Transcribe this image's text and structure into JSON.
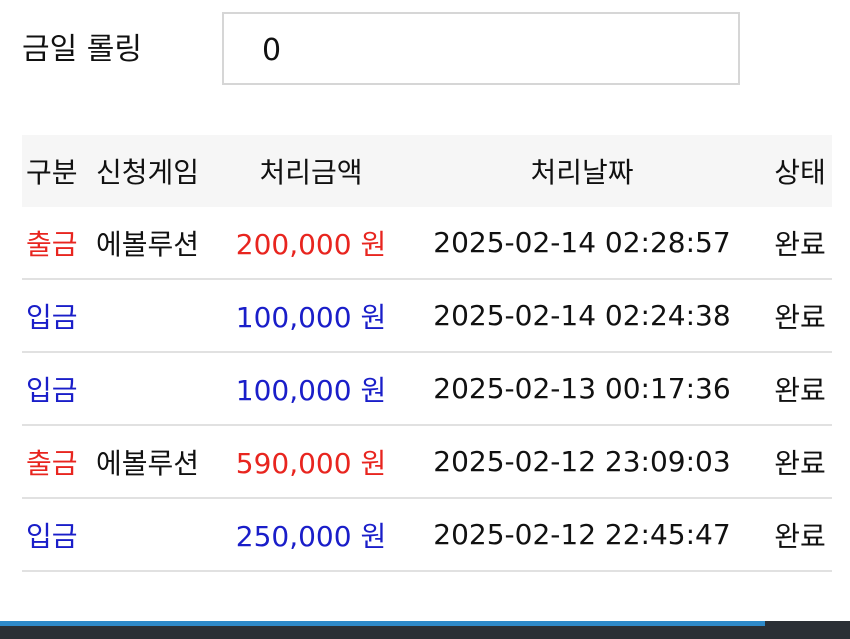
{
  "rolling": {
    "label": "금일 롤링",
    "value": "0"
  },
  "table": {
    "headers": {
      "type": "구분",
      "game": "신청게임",
      "amount": "처리금액",
      "date": "처리날짜",
      "status": "상태"
    },
    "rows": [
      {
        "type": "출금",
        "kind": "withdraw",
        "game": "에볼루션",
        "amount": "200,000 원",
        "date": "2025-02-14 02:28:57",
        "status": "완료"
      },
      {
        "type": "입금",
        "kind": "deposit",
        "game": "",
        "amount": "100,000 원",
        "date": "2025-02-14 02:24:38",
        "status": "완료"
      },
      {
        "type": "입금",
        "kind": "deposit",
        "game": "",
        "amount": "100,000 원",
        "date": "2025-02-13 00:17:36",
        "status": "완료"
      },
      {
        "type": "출금",
        "kind": "withdraw",
        "game": "에볼루션",
        "amount": "590,000 원",
        "date": "2025-02-12 23:09:03",
        "status": "완료"
      },
      {
        "type": "입금",
        "kind": "deposit",
        "game": "",
        "amount": "250,000 원",
        "date": "2025-02-12 22:45:47",
        "status": "완료"
      }
    ]
  },
  "colors": {
    "withdraw": "#e8251f",
    "deposit": "#1a1ec9",
    "header_bg": "#f6f6f6",
    "row_border": "#e1e1e1",
    "bottom_bar": "#2b2f35",
    "bottom_accent": "#2e89c9"
  }
}
